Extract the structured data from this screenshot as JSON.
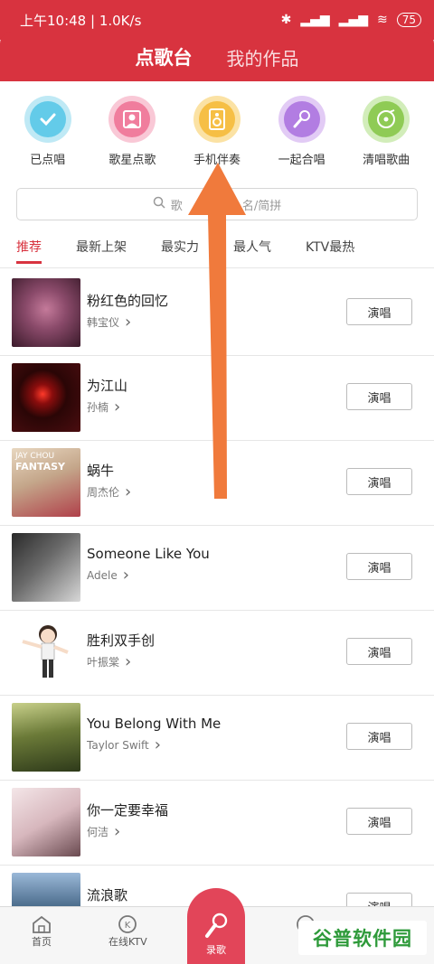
{
  "status_bar": {
    "time": "上午10:48 | 1.0K/s",
    "battery": "75"
  },
  "header": {
    "tabs": [
      {
        "label": "点歌台"
      },
      {
        "label": "我的作品"
      }
    ]
  },
  "quick_actions": [
    {
      "label": "已点唱",
      "icon": "check-icon",
      "color": "#63cbe9"
    },
    {
      "label": "歌星点歌",
      "icon": "singer-icon",
      "color": "#f07d9d"
    },
    {
      "label": "手机伴奏",
      "icon": "speaker-icon",
      "color": "#f6bf45"
    },
    {
      "label": "一起合唱",
      "icon": "microphone-icon",
      "color": "#b27de2"
    },
    {
      "label": "清唱歌曲",
      "icon": "vinyl-icon",
      "color": "#8fcb55"
    }
  ],
  "search": {
    "placeholder_left": "歌",
    "placeholder_right": "名/简拼"
  },
  "categories": [
    {
      "label": "推荐"
    },
    {
      "label": "最新上架"
    },
    {
      "label": "最实力"
    },
    {
      "label": "最人气"
    },
    {
      "label": "KTV最热"
    }
  ],
  "songs": [
    {
      "title": "粉红色的回忆",
      "artist": "韩宝仪",
      "cover": "#8a4a6a"
    },
    {
      "title": "为江山",
      "artist": "孙楠",
      "cover": "#4b0d10"
    },
    {
      "title": "蜗牛",
      "artist": "周杰伦",
      "cover": "#c4a68a",
      "cover_text": [
        "JAY CHOU",
        "FANTASY"
      ]
    },
    {
      "title": "Someone Like You",
      "artist": "Adele",
      "cover": "#505050"
    },
    {
      "title": "胜利双手创",
      "artist": "叶振棠",
      "cover": "#ffffff"
    },
    {
      "title": "You Belong With Me",
      "artist": "Taylor Swift",
      "cover": "#6b7a38"
    },
    {
      "title": "你一定要幸福",
      "artist": "何洁",
      "cover": "#d7b7bd"
    },
    {
      "title": "流浪歌",
      "artist": "",
      "cover": "#4a6b8a"
    }
  ],
  "sing_label": "演唱",
  "tabbar": {
    "home": "首页",
    "ktv": "在线KTV",
    "record": "录歌"
  },
  "watermark": "谷普软件园",
  "accent": "#d8333f",
  "arrow_color": "#f07a3c"
}
